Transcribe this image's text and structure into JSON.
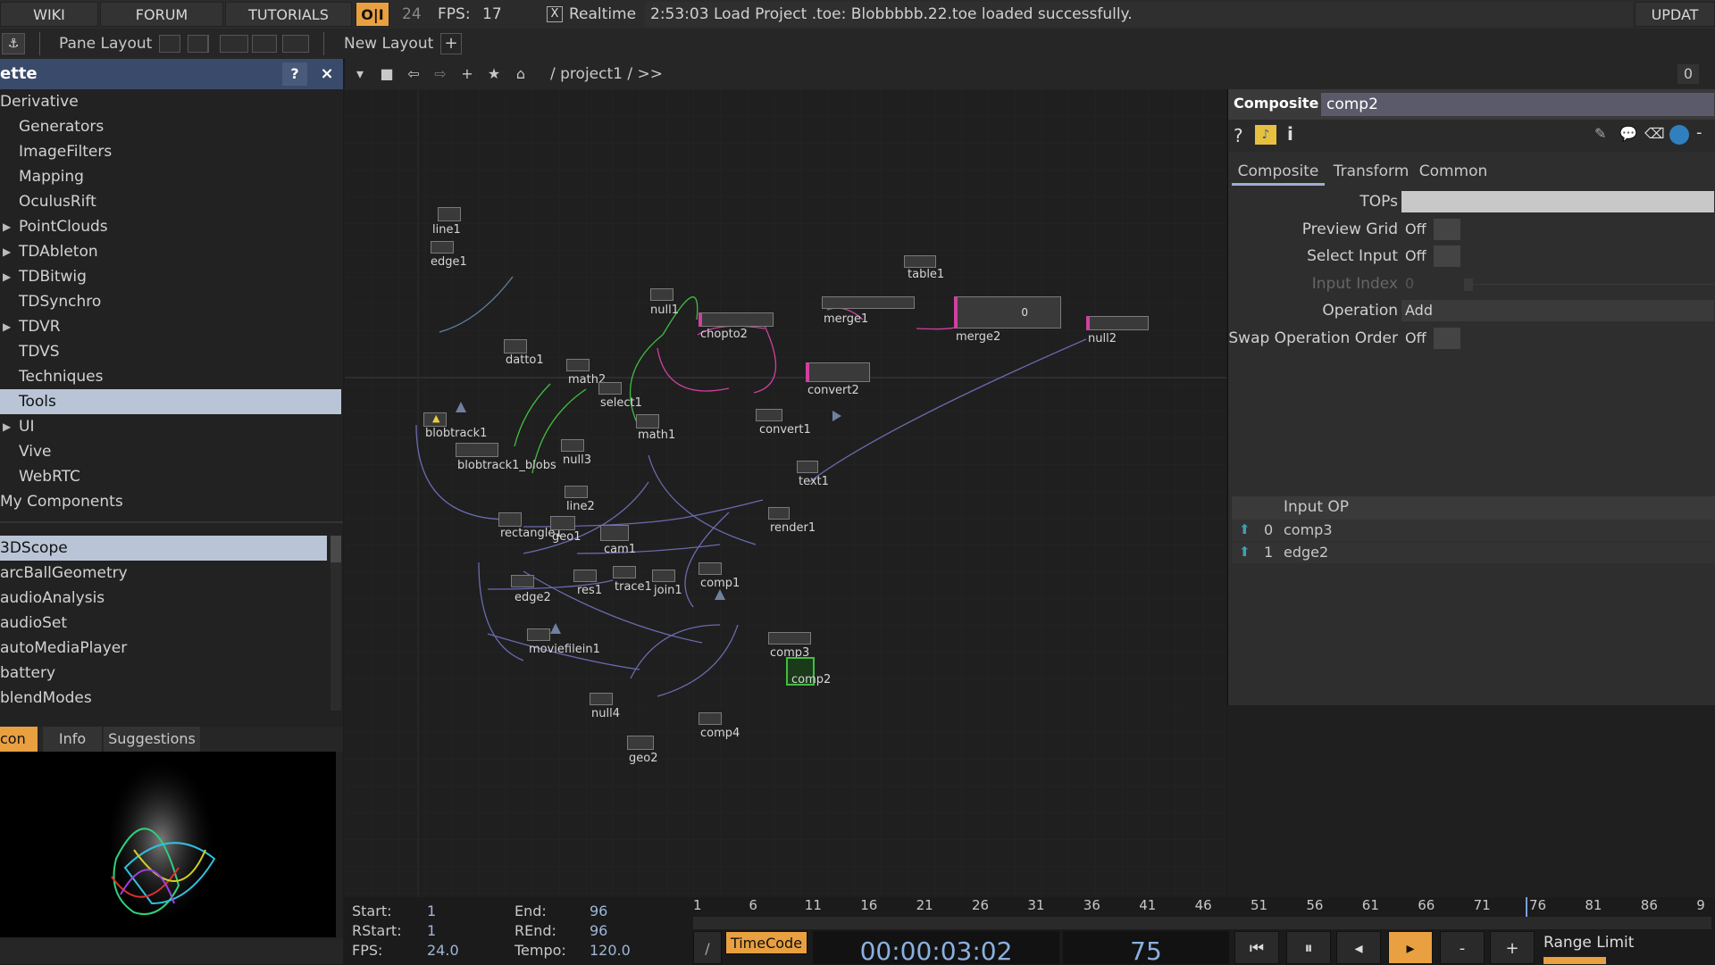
{
  "menubar": {
    "wiki": "WIKI",
    "forum": "FORUM",
    "tutorials": "TUTORIALS",
    "oi": "O|I",
    "fps_target": "24",
    "fps_label": "FPS:",
    "fps_value": "17",
    "realtime_check": "X",
    "realtime": "Realtime",
    "status": "2:53:03 Load Project .toe: Blobbbbb.22.toe loaded successfully.",
    "update": "UPDAT"
  },
  "panebar": {
    "pane_layout": "Pane Layout",
    "new_layout": "New Layout",
    "add": "+"
  },
  "palette": {
    "title": "ette",
    "help": "?",
    "close": "×",
    "tree": [
      {
        "label": "Derivative",
        "indent": false,
        "arrow": false
      },
      {
        "label": "Generators",
        "indent": true,
        "arrow": false
      },
      {
        "label": "ImageFilters",
        "indent": true,
        "arrow": false
      },
      {
        "label": "Mapping",
        "indent": true,
        "arrow": false
      },
      {
        "label": "OculusRift",
        "indent": true,
        "arrow": false
      },
      {
        "label": "PointClouds",
        "indent": true,
        "arrow": true
      },
      {
        "label": "TDAbleton",
        "indent": true,
        "arrow": true
      },
      {
        "label": "TDBitwig",
        "indent": true,
        "arrow": true
      },
      {
        "label": "TDSynchro",
        "indent": true,
        "arrow": false
      },
      {
        "label": "TDVR",
        "indent": true,
        "arrow": true
      },
      {
        "label": "TDVS",
        "indent": true,
        "arrow": false
      },
      {
        "label": "Techniques",
        "indent": true,
        "arrow": false
      },
      {
        "label": "Tools",
        "indent": true,
        "arrow": false,
        "selected": true
      },
      {
        "label": "UI",
        "indent": true,
        "arrow": true
      },
      {
        "label": "Vive",
        "indent": true,
        "arrow": false
      },
      {
        "label": "WebRTC",
        "indent": true,
        "arrow": false
      },
      {
        "label": "My Components",
        "indent": false,
        "arrow": false
      }
    ],
    "list": [
      "3DScope",
      "arcBallGeometry",
      "audioAnalysis",
      "audioSet",
      "autoMediaPlayer",
      "battery",
      "blendModes"
    ],
    "tabs": [
      "con",
      "Info",
      "Suggestions"
    ]
  },
  "netbar": {
    "path": "/ project1 / >>",
    "right_value": "0"
  },
  "nodes": [
    {
      "name": "line1"
    },
    {
      "name": "edge1"
    },
    {
      "name": "null1"
    },
    {
      "name": "chopto2"
    },
    {
      "name": "merge1"
    },
    {
      "name": "merge2",
      "value": "0"
    },
    {
      "name": "null2"
    },
    {
      "name": "table1"
    },
    {
      "name": "datto1"
    },
    {
      "name": "math2"
    },
    {
      "name": "select1"
    },
    {
      "name": "math1"
    },
    {
      "name": "convert2"
    },
    {
      "name": "convert1"
    },
    {
      "name": "blobtrack1"
    },
    {
      "name": "blobtrack1_blobs"
    },
    {
      "name": "null3"
    },
    {
      "name": "text1"
    },
    {
      "name": "line2"
    },
    {
      "name": "rectangle1"
    },
    {
      "name": "geo1"
    },
    {
      "name": "cam1"
    },
    {
      "name": "render1"
    },
    {
      "name": "res1"
    },
    {
      "name": "trace1"
    },
    {
      "name": "join1"
    },
    {
      "name": "comp1"
    },
    {
      "name": "edge2"
    },
    {
      "name": "moviefilein1"
    },
    {
      "name": "comp3"
    },
    {
      "name": "comp2"
    },
    {
      "name": "null4"
    },
    {
      "name": "comp4"
    },
    {
      "name": "geo2"
    }
  ],
  "params": {
    "type": "Composite",
    "op_name": "comp2",
    "tabs": [
      "Composite",
      "Transform",
      "Common"
    ],
    "rows": [
      {
        "label": "TOPs",
        "value": ""
      },
      {
        "label": "Preview Grid",
        "value": "Off"
      },
      {
        "label": "Select Input",
        "value": "Off"
      },
      {
        "label": "Input Index",
        "value": "0"
      },
      {
        "label": "Operation",
        "value": "Add"
      },
      {
        "label": "Swap Operation Order",
        "value": "Off"
      }
    ],
    "inputs_header": "Input OP",
    "inputs": [
      {
        "index": "0",
        "name": "comp3"
      },
      {
        "index": "1",
        "name": "edge2"
      }
    ]
  },
  "timeline": {
    "start_label": "Start:",
    "start": "1",
    "rstart_label": "RStart:",
    "rstart": "1",
    "fps_label": "FPS:",
    "fps": "24.0",
    "end_label": "End:",
    "end": "96",
    "rend_label": "REnd:",
    "rend": "96",
    "tempo_label": "Tempo:",
    "tempo": "120.0",
    "ticks": [
      "1",
      "6",
      "11",
      "16",
      "21",
      "26",
      "31",
      "36",
      "41",
      "46",
      "51",
      "56",
      "61",
      "66",
      "71",
      "76",
      "81",
      "86",
      "9"
    ],
    "timecode_btn": "TimeCode",
    "timecode": "00:00:03:02",
    "frame": "75",
    "range_limit": "Range Limit"
  },
  "colors": {
    "accent": "#e8a040",
    "selected_node": "#3fbf3f",
    "title_bar": "#3a4a6a"
  }
}
